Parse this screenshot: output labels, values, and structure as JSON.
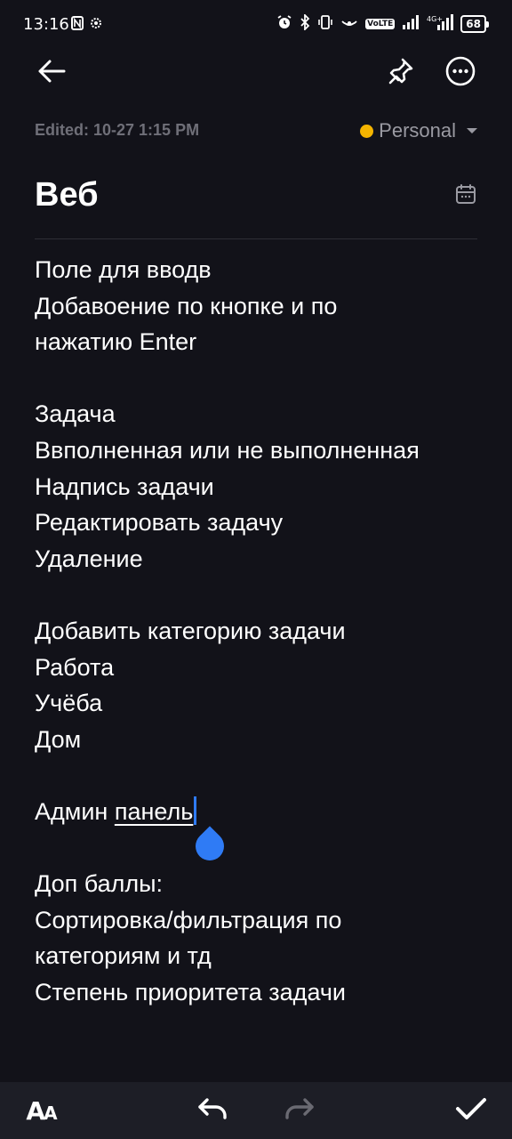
{
  "status_bar": {
    "time": "13:16",
    "battery": "68",
    "network": "4G+",
    "lte": "VoLTE"
  },
  "toolbar": {
    "back_icon": "arrow-left-icon",
    "pin_icon": "pin-icon",
    "more_icon": "more-icon"
  },
  "meta": {
    "edited": "Edited: 10-27 1:15 PM",
    "folder": "Personal",
    "folder_color": "#f4b400"
  },
  "note": {
    "title": "Веб",
    "lines": [
      "Поле для вводв",
      "Добавоение по кнопке и по",
      "нажатию Enter",
      "",
      "Задача",
      "Ввполненная или не выполненная",
      "Надпись задачи",
      "Редактировать задачу",
      "Удаление",
      "",
      "Добавить категорию задачи",
      "Работа",
      "Учёба",
      "Дом",
      ""
    ],
    "admin_word": "Админ",
    "admin_underlined": "панель",
    "lines_after": [
      "",
      "Доп баллы:",
      "Сортировка/фильтрация по",
      "категориям и тд",
      "Степень приоритета задачи"
    ]
  },
  "bottom_bar": {
    "format_label": "A",
    "format_label_small": "A",
    "accent": "#2f7bf5"
  }
}
